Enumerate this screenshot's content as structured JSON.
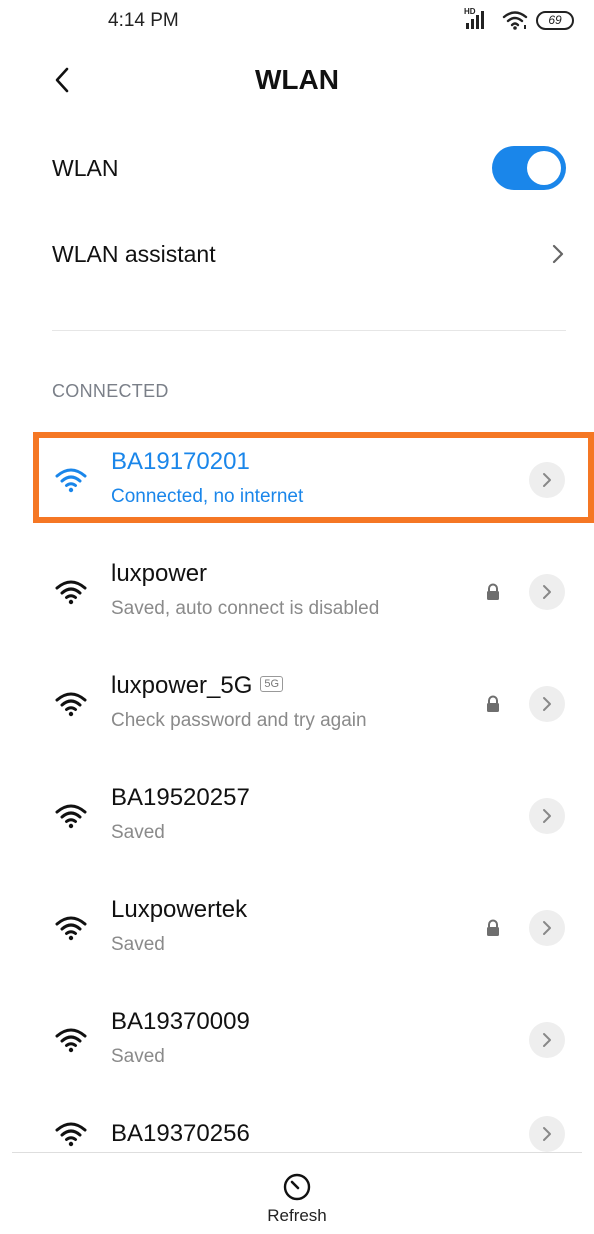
{
  "status_bar": {
    "time": "4:14 PM",
    "signal_badge": "HD",
    "battery": "69"
  },
  "header": {
    "back_icon": "chevron-left-icon",
    "title": "WLAN"
  },
  "settings": {
    "wlan_label": "WLAN",
    "wlan_enabled": true,
    "assistant_label": "WLAN assistant"
  },
  "connected_section": {
    "header": "CONNECTED"
  },
  "networks": [
    {
      "name": "BA19170201",
      "status": "Connected, no internet",
      "connected": true,
      "locked": false,
      "badge": ""
    },
    {
      "name": "luxpower",
      "status": "Saved, auto connect is disabled",
      "connected": false,
      "locked": true,
      "badge": ""
    },
    {
      "name": "luxpower_5G",
      "status": "Check password and try again",
      "connected": false,
      "locked": true,
      "badge": "5G"
    },
    {
      "name": "BA19520257",
      "status": "Saved",
      "connected": false,
      "locked": false,
      "badge": ""
    },
    {
      "name": "Luxpowertek",
      "status": "Saved",
      "connected": false,
      "locked": true,
      "badge": ""
    },
    {
      "name": "BA19370009",
      "status": "Saved",
      "connected": false,
      "locked": false,
      "badge": ""
    },
    {
      "name": "BA19370256",
      "status": "",
      "connected": false,
      "locked": false,
      "badge": ""
    }
  ],
  "bottom_bar": {
    "refresh_label": "Refresh"
  },
  "colors": {
    "accent": "#1a86ea",
    "highlight": "#f57724",
    "secondary_text": "#8a8a8a"
  }
}
